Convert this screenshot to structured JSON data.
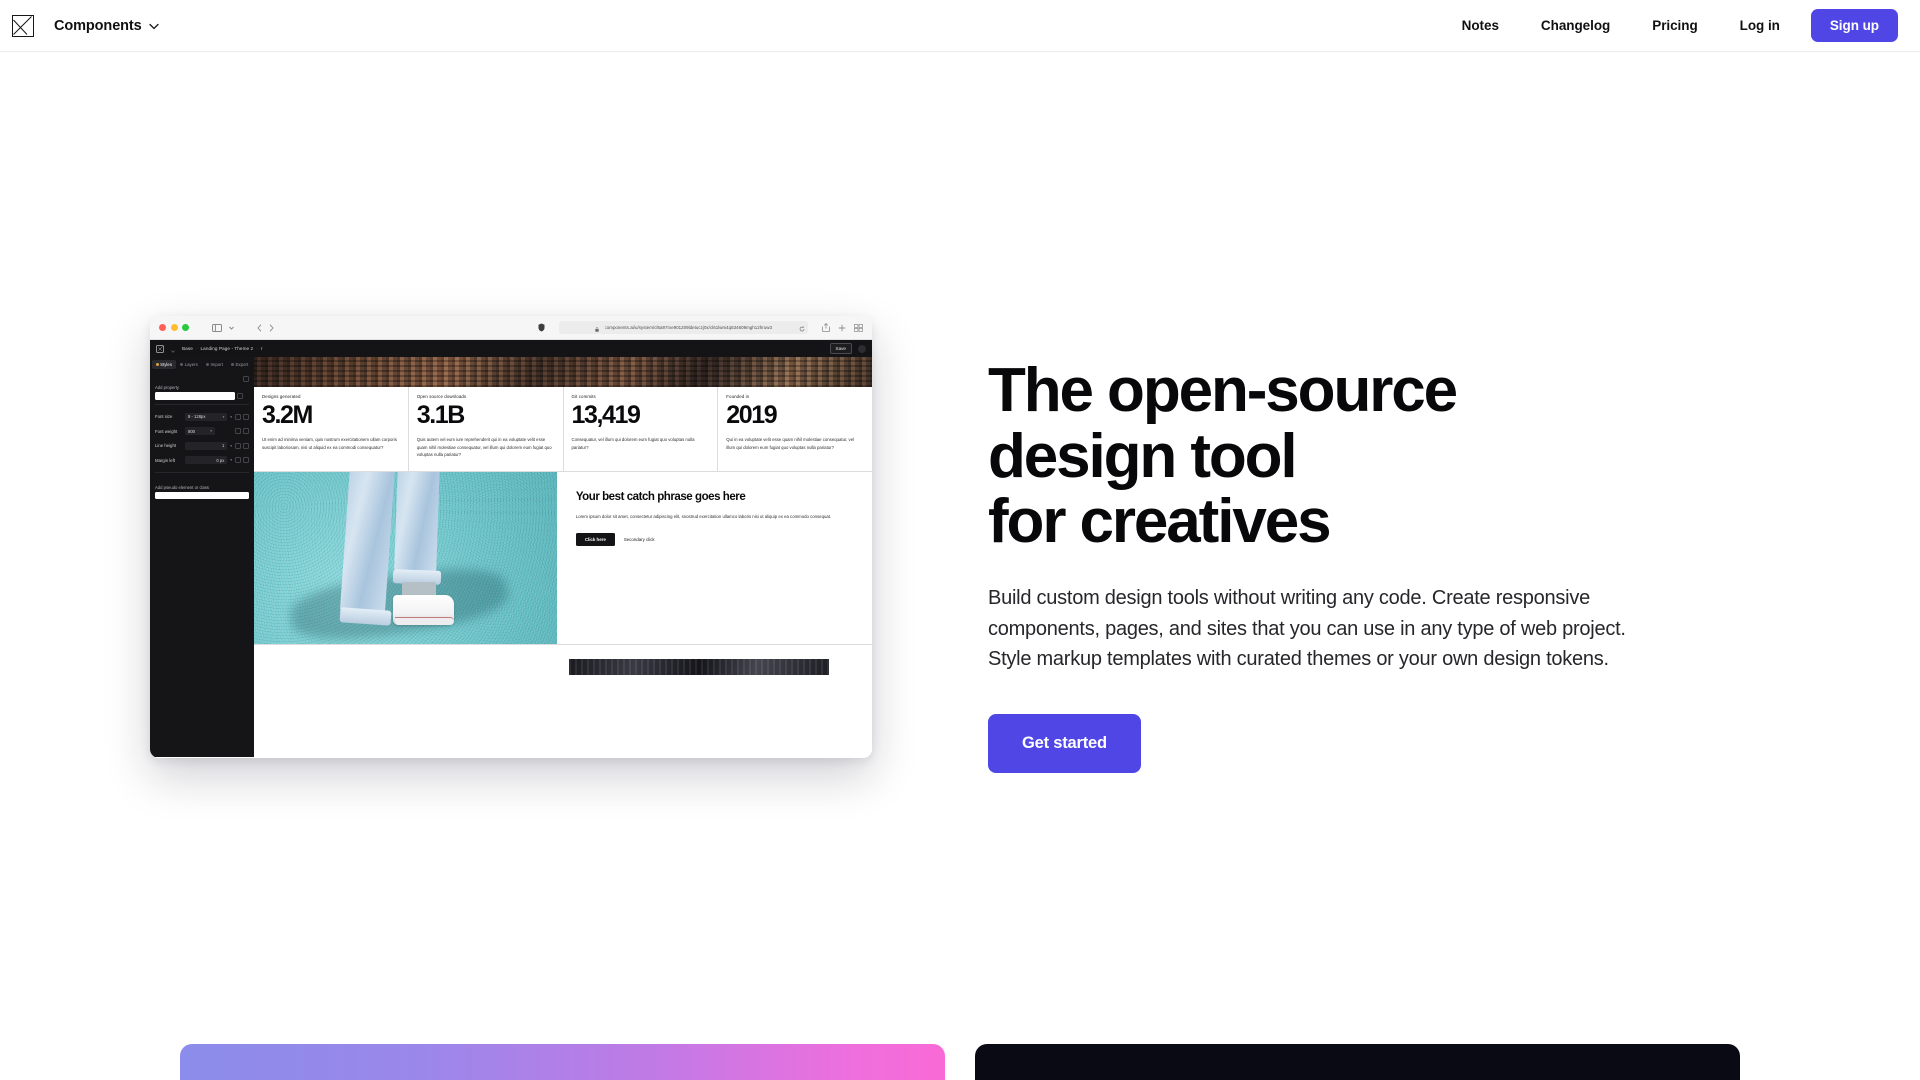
{
  "nav": {
    "logo_icon": "image-placeholder-icon",
    "brand": "Components",
    "chevron_icon": "chevron-down-icon",
    "links": [
      {
        "label": "Notes"
      },
      {
        "label": "Changelog"
      },
      {
        "label": "Pricing"
      },
      {
        "label": "Log in"
      }
    ],
    "signup_label": "Sign up",
    "accent_color": "#4f46e5"
  },
  "hero": {
    "title_line1": "The open-source",
    "title_line2": "design tool",
    "title_line3": "for creatives",
    "subtitle": "Build custom design tools without writing any code. Create responsive components, pages, and sites that you can use in any type of web project. Style markup templates with curated themes or your own design tokens.",
    "cta_label": "Get started"
  },
  "mockup": {
    "browser": {
      "traffic_lights": [
        "#ff5f56",
        "#ffbd2e",
        "#27c93f"
      ],
      "sidebar_toggle_icon": "sidebar-toggle-icon",
      "back_icon": "chevron-left-icon",
      "forward_icon": "chevron-right-icon",
      "shield_icon": "privacy-shield-icon",
      "lock_icon": "lock-icon",
      "url": "components.ai/u/system/cl5a97rxe901209ldetuczj0x/cl61lwm4q534609mgh12hruw3",
      "reload_icon": "reload-icon",
      "share_icon": "share-icon",
      "new_tab_icon": "plus-icon",
      "tabs_icon": "tabs-overview-icon"
    },
    "appbar": {
      "logo_icon": "app-logo-icon",
      "breadcrumb": [
        "Base",
        "Landing Page - Theme 2",
        "r"
      ],
      "save_label": "Save",
      "avatar_icon": "avatar-icon"
    },
    "sidebar": {
      "tabs": [
        {
          "label": "Styles",
          "active": true
        },
        {
          "label": "Layers",
          "active": false
        },
        {
          "label": "Import",
          "active": false
        },
        {
          "label": "Export",
          "active": false
        }
      ],
      "add_property_label": "Add property",
      "add_property_value": "",
      "properties": [
        {
          "name": "Font size",
          "value": "8 - 128px"
        },
        {
          "name": "Font weight",
          "value": "800"
        },
        {
          "name": "Line height",
          "value": "1"
        },
        {
          "name": "Margin left",
          "value": "0 px"
        }
      ],
      "pseudo_label": "Add pseudo element or class",
      "pseudo_value": ""
    },
    "canvas": {
      "banner_image": "aerial-cityscape-photo",
      "stats": [
        {
          "label": "Designs generated",
          "value": "3.2M",
          "body": "Ut enim ad minima veniam, quis nostrum exercitationem ullam corporis suscipit laboriosam, nisi ut aliquid ex ea commodi consequatur?"
        },
        {
          "label": "Open source downloads",
          "value": "3.1B",
          "body": "Quis autem vel eum iure reprehenderit qui in ea voluptate velit esse quam nihil molestiae consequatur, vel illum qui dolorem eum fugiat quo voluptas nulla pariatur?"
        },
        {
          "label": "Git commits",
          "value": "13,419",
          "body": "Consequatur, vel illum qui dolorem eum fugiat quo voluptas nulla pariatur?"
        },
        {
          "label": "Founded in",
          "value": "2019",
          "body": "Qui in ea voluptate velit esse quam nihil molestiae consequatur, vel illum qui dolorem eum fugiat quo voluptas nulla pariatur?"
        }
      ],
      "hero_photo": "jeans-and-sneakers-on-teal-pavement-photo",
      "hero_heading_line1": "Your best catch",
      "hero_heading_line2": "phrase goes here",
      "hero_body": "Lorem ipsum dolor sit amet, consectetur adipiscing elit, snostrud exercitation ullamco laboris nisi ut aliquip ex ea commodo consequat.",
      "primary_btn": "Click here",
      "secondary_link": "Secondary click",
      "bottom_image": "dark-photo-strip"
    }
  },
  "cards": [
    {
      "name": "gradient-card",
      "gradient_from": "#8b8ceb",
      "gradient_to": "#fa6ad6"
    },
    {
      "name": "dark-card",
      "color": "#0a0a14"
    }
  ]
}
